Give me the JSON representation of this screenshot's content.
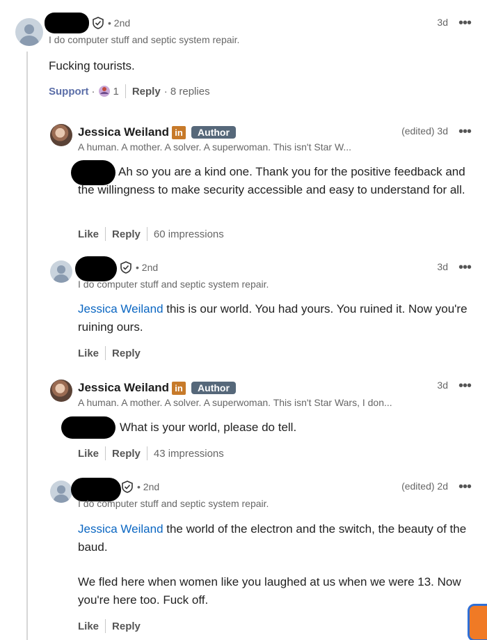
{
  "comments": [
    {
      "degree": "• 2nd",
      "headline": "I do computer stuff and septic system repair.",
      "time": "3d",
      "text": "Fucking tourists.",
      "actions": {
        "support": "Support",
        "reaction_count": "1",
        "reply": "Reply",
        "replies": "· 8 replies"
      }
    },
    {
      "name": "Jessica Weiland",
      "li": "in",
      "badge": "Author",
      "headline": "A human. A mother. A solver. A superwoman. This isn't Star W...",
      "time": "(edited) 3d",
      "text": "Ah so you are a kind one. Thank you for the positive feedback and the willingness to make security accessible and easy to understand for all.",
      "actions": {
        "like": "Like",
        "reply": "Reply",
        "impressions": "60 impressions"
      }
    },
    {
      "degree": "• 2nd",
      "headline": "I do computer stuff and septic system repair.",
      "time": "3d",
      "mention": "Jessica Weiland",
      "text": " this is our world. You had yours. You ruined it. Now you're ruining ours.",
      "actions": {
        "like": "Like",
        "reply": "Reply"
      }
    },
    {
      "name": "Jessica Weiland",
      "li": "in",
      "badge": "Author",
      "headline": "A human. A mother. A solver. A superwoman. This isn't Star Wars, I don...",
      "time": "3d",
      "text": "What is your world, please do tell.",
      "actions": {
        "like": "Like",
        "reply": "Reply",
        "impressions": "43 impressions"
      }
    },
    {
      "degree": "• 2nd",
      "headline": "I do computer stuff and septic system repair.",
      "time": "(edited) 2d",
      "mention": "Jessica Weiland",
      "text": " the world of the electron and the switch, the beauty of the baud.",
      "text2": "We fled here when women like you laughed at us when we were 13. Now you're here too. Fuck off.",
      "actions": {
        "like": "Like",
        "reply": "Reply"
      }
    }
  ],
  "menu_glyph": "•••",
  "icons": [
    "default-avatar-icon",
    "verified-shield-icon",
    "overflow-menu-icon",
    "support-reaction-icon",
    "linkedin-icon"
  ],
  "colors": {
    "mention": "#0a66c2",
    "author_badge": "#56687a",
    "linkedin_badge": "#c77a2a"
  }
}
